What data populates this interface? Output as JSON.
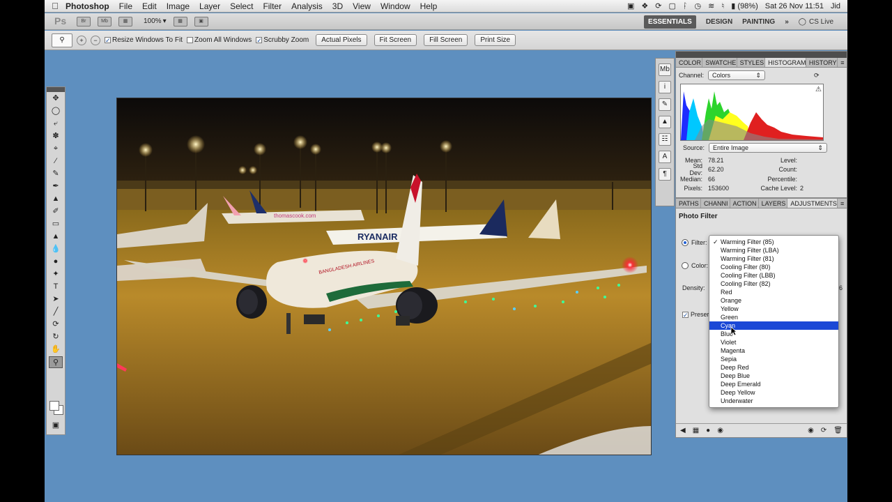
{
  "menubar": {
    "app": "Photoshop",
    "items": [
      "File",
      "Edit",
      "Image",
      "Layer",
      "Select",
      "Filter",
      "Analysis",
      "3D",
      "View",
      "Window",
      "Help"
    ],
    "battery": "(98%)",
    "datetime": "Sat 26 Nov  11:51",
    "user": "Jid"
  },
  "appbar": {
    "logo": "Ps",
    "icon1": "Br",
    "icon2": "Mb",
    "zoom": "100%",
    "workspaces": [
      "ESSENTIALS",
      "DESIGN",
      "PAINTING"
    ],
    "more": "»",
    "cslive": "CS Live"
  },
  "options": {
    "resize_windows": "Resize Windows To Fit",
    "zoom_all": "Zoom All Windows",
    "scrubby": "Scrubby Zoom",
    "actual_pixels": "Actual Pixels",
    "fit_screen": "Fit Screen",
    "fill_screen": "Fill Screen",
    "print_size": "Print Size"
  },
  "panel_top": {
    "tabs": [
      "COLOR",
      "SWATCHE",
      "STYLES",
      "HISTOGRAM",
      "HISTORY"
    ],
    "channel_label": "Channel:",
    "channel_value": "Colors",
    "source_label": "Source:",
    "source_value": "Entire Image",
    "stats": {
      "mean_label": "Mean:",
      "mean": "78.21",
      "stddev_label": "Std Dev:",
      "stddev": "62.20",
      "median_label": "Median:",
      "median": "66",
      "pixels_label": "Pixels:",
      "pixels": "153600",
      "level_label": "Level:",
      "count_label": "Count:",
      "percentile_label": "Percentile:",
      "cache_label": "Cache Level:",
      "cache": "2"
    }
  },
  "panel_adjust": {
    "tabs": [
      "PATHS",
      "CHANNI",
      "ACTION",
      "LAYERS",
      "ADJUSTMENTS"
    ],
    "title": "Photo Filter",
    "filter_label": "Filter:",
    "color_label": "Color:",
    "density_label": "Density:",
    "density_value": "6",
    "preserve_label": "Preserv"
  },
  "dropdown": {
    "checked": "Warming Filter (85)",
    "highlighted": "Cyan",
    "options": [
      "Warming Filter (85)",
      "Warming Filter (LBA)",
      "Warming Filter (81)",
      "Cooling Filter (80)",
      "Cooling Filter (LBB)",
      "Cooling Filter (82)",
      "Red",
      "Orange",
      "Yellow",
      "Green",
      "Cyan",
      "Blue",
      "Violet",
      "Magenta",
      "Sepia",
      "Deep Red",
      "Deep Blue",
      "Deep Emerald",
      "Deep Yellow",
      "Underwater"
    ]
  },
  "photo": {
    "ryanair_text": "RYANAIR",
    "thomas_text": "thomascook.com",
    "airline_text": "BANGLADESH AIRLINES"
  },
  "colors": {
    "canvas_bg": "#5e8fbf",
    "highlight": "#1b48d6"
  }
}
